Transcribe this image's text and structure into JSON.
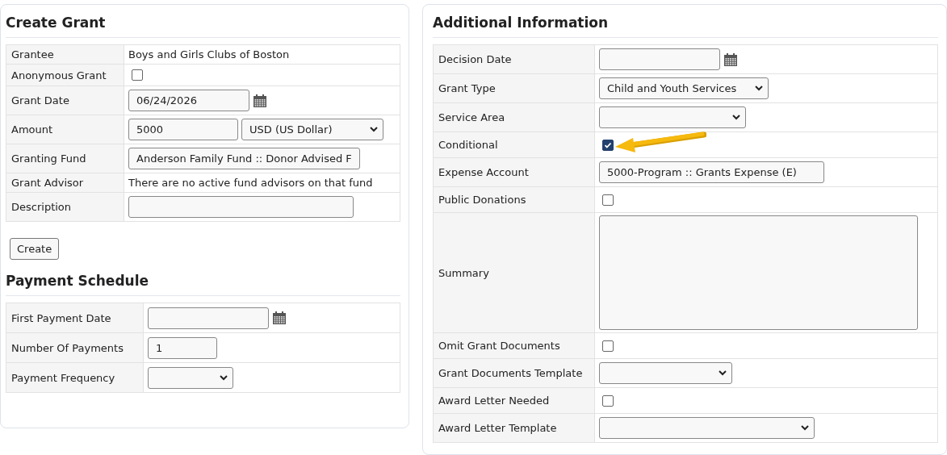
{
  "create_grant": {
    "title": "Create Grant",
    "rows": [
      {
        "label": "Grantee",
        "kind": "text",
        "value": "Boys and Girls Clubs of Boston"
      },
      {
        "label": "Anonymous Grant",
        "kind": "checkbox",
        "checked": false
      },
      {
        "label": "Grant Date",
        "kind": "date",
        "value": "06/24/2026"
      },
      {
        "label": "Amount",
        "kind": "amount",
        "value": "5000",
        "currency": "USD (US Dollar)"
      },
      {
        "label": "Granting Fund",
        "kind": "input",
        "value": "Anderson Family Fund :: Donor Advised F"
      },
      {
        "label": "Grant Advisor",
        "kind": "text",
        "value": "There are no active fund advisors on that fund"
      },
      {
        "label": "Description",
        "kind": "input",
        "value": ""
      }
    ],
    "button": "Create"
  },
  "payment_schedule": {
    "title": "Payment Schedule",
    "rows": [
      {
        "label": "First Payment Date",
        "kind": "date",
        "value": ""
      },
      {
        "label": "Number Of Payments",
        "kind": "input",
        "value": "1"
      },
      {
        "label": "Payment Frequency",
        "kind": "select",
        "value": ""
      }
    ]
  },
  "additional_information": {
    "title": "Additional Information",
    "rows": [
      {
        "label": "Decision Date",
        "kind": "date",
        "value": ""
      },
      {
        "label": "Grant Type",
        "kind": "select",
        "value": "Child and Youth Services"
      },
      {
        "label": "Service Area",
        "kind": "select",
        "value": ""
      },
      {
        "label": "Conditional",
        "kind": "checkbox",
        "checked": true,
        "arrow": true
      },
      {
        "label": "Expense Account",
        "kind": "input",
        "value": "5000-Program :: Grants Expense (E)"
      },
      {
        "label": "Public Donations",
        "kind": "checkbox",
        "checked": false
      },
      {
        "label": "Summary",
        "kind": "textarea",
        "value": ""
      },
      {
        "label": "Omit Grant Documents",
        "kind": "checkbox",
        "checked": false
      },
      {
        "label": "Grant Documents Template",
        "kind": "select",
        "value": ""
      },
      {
        "label": "Award Letter Needed",
        "kind": "checkbox",
        "checked": false
      },
      {
        "label": "Award Letter Template",
        "kind": "select",
        "value": ""
      }
    ]
  }
}
